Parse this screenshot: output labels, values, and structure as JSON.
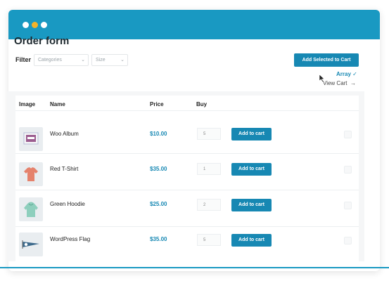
{
  "page": {
    "title": "Order form",
    "filter_label": "Filter",
    "filters": {
      "categories_placeholder": "Categories",
      "size_placeholder": "Size"
    },
    "add_selected_label": "Add Selected to Cart",
    "array_label": "Array",
    "view_cart_label": "View Cart",
    "columns": [
      "Image",
      "Name",
      "Price",
      "Buy"
    ]
  },
  "products": [
    {
      "name": "Woo Album",
      "price": "$10.00",
      "qty": "5",
      "button": "Add to cart",
      "icon": "album-icon"
    },
    {
      "name": "Red T-Shirt",
      "price": "$35.00",
      "qty": "1",
      "button": "Add to cart",
      "icon": "tshirt-icon"
    },
    {
      "name": "Green Hoodie",
      "price": "$25.00",
      "qty": "2",
      "button": "Add to cart",
      "icon": "hoodie-icon"
    },
    {
      "name": "WordPress Flag",
      "price": "$35.00",
      "qty": "5",
      "button": "Add to cart",
      "icon": "flag-icon"
    }
  ],
  "colors": {
    "accent": "#1788b3",
    "titlebar": "#1999c2",
    "dot_yellow": "#f2b32a"
  }
}
